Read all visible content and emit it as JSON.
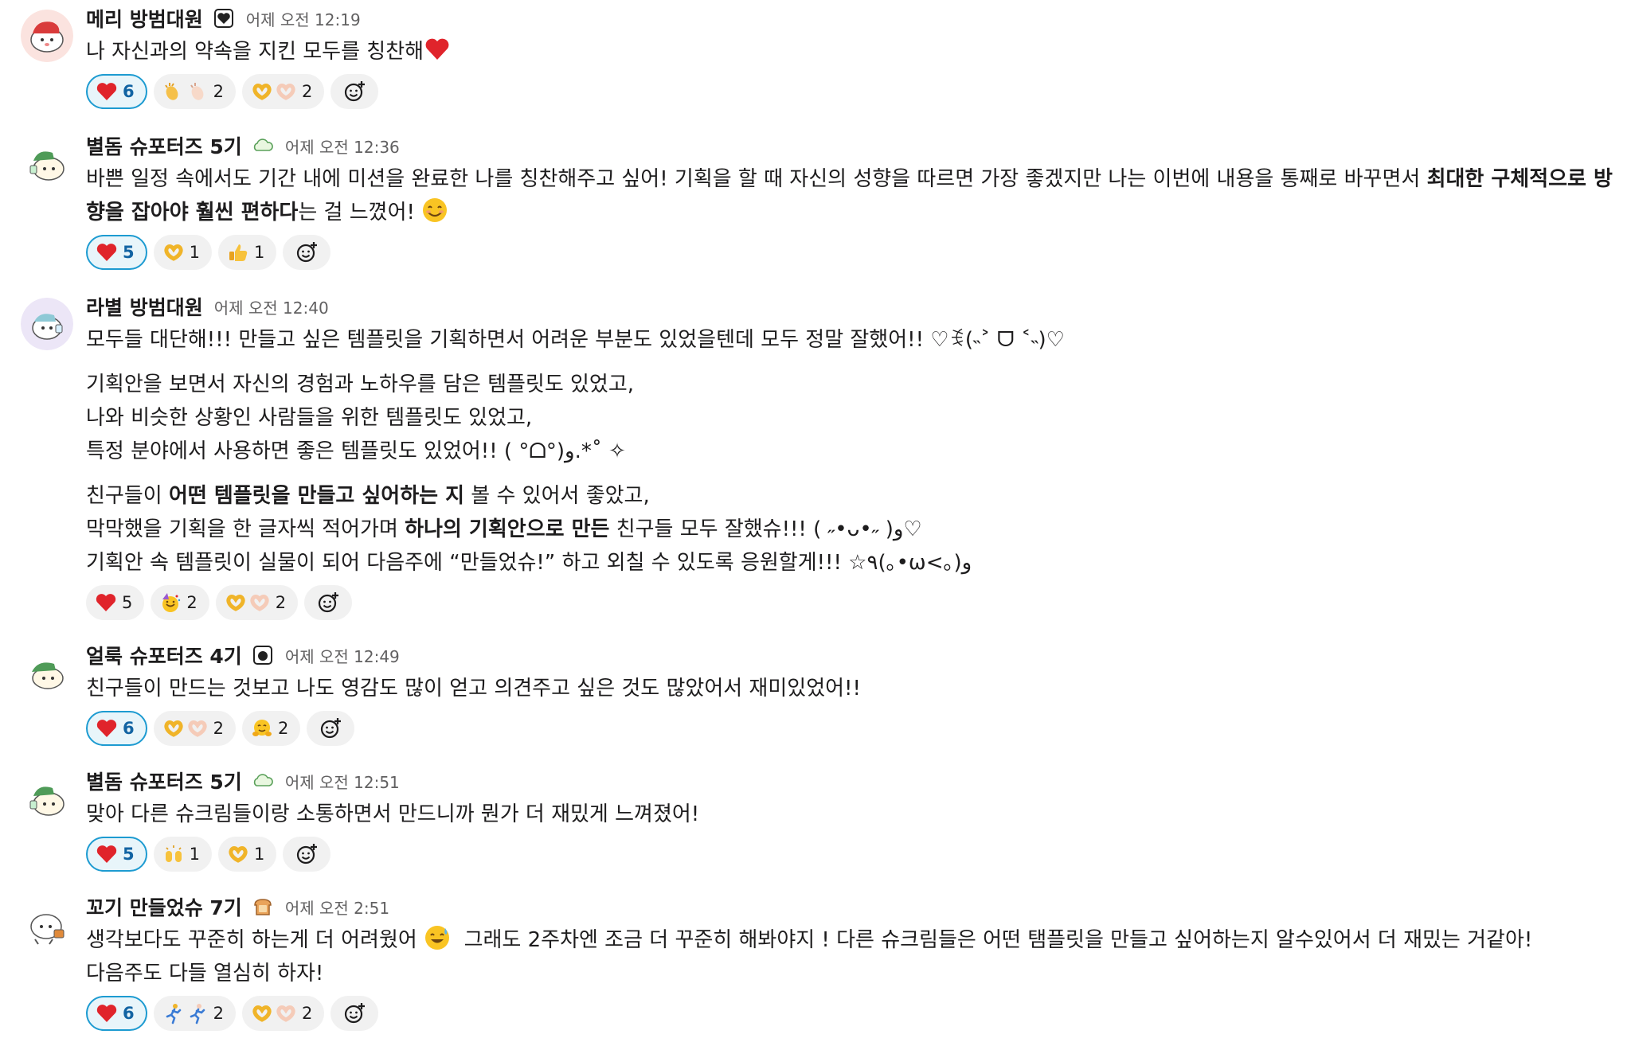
{
  "messages": [
    {
      "author": "메리 방범대원",
      "time": "어제 오전 12:19",
      "lines": [
        "나 자신과의 약속을 지킨 모두를 칭찬해"
      ],
      "reactions": [
        {
          "emoji": "heart",
          "count": "6",
          "mine": true
        },
        {
          "emoji": "clap",
          "count": "2"
        },
        {
          "emoji": "heart-hands",
          "count": "2"
        }
      ]
    },
    {
      "author": "별돔 슈포터즈 5기",
      "time": "어제 오전 12:36",
      "text_a": "바쁜 일정 속에서도 기간 내에 미션을 완료한 나를 칭찬해주고 싶어! 기획을 할 때 자신의 성향을 따르면 가장 좋겠지만 나는 이번에 내용을 통째로 바꾸면서 ",
      "text_bold": "최대한 구체적으로 방향을 잡아야 훨씬 편하다",
      "text_b": "는 걸 느꼈어!",
      "reactions": [
        {
          "emoji": "heart",
          "count": "5",
          "mine": true
        },
        {
          "emoji": "heart-hands",
          "count": "1"
        },
        {
          "emoji": "thumbs-up",
          "count": "1"
        }
      ]
    },
    {
      "author": "라별 방범대원",
      "time": "어제 오전 12:40",
      "p1": "모두들 대단해!!! 만들고 싶은 템플릿을 기획하면서 어려운 부분도 있었을텐데 모두 정말 잘했어!! ♡ꉂ(˵˃ ᗜ ˂˵)♡",
      "p2_lines": [
        "기획안을 보면서 자신의 경험과 노하우를 담은 템플릿도 있었고,",
        "나와 비슷한 상황인 사람들을 위한 템플릿도 있었고,",
        "특정 분야에서 사용하면 좋은 템플릿도 있었어!! ( °ᗝ°)و.*˚ ✧"
      ],
      "p3_l1_a": "친구들이 ",
      "p3_l1_bold": "어떤 템플릿을 만들고 싶어하는 지",
      "p3_l1_b": " 볼 수 있어서 좋았고,",
      "p3_l2_a": "막막했을 기획을 한 글자씩 적어가며 ",
      "p3_l2_bold": "하나의 기획안으로 만든",
      "p3_l2_b": " 친구들 모두 잘했슈!!! ( ˶•ᴗ•˶ )و♡",
      "p3_l3": "기획안 속 템플릿이 실물이 되어 다음주에 “만들었슈!” 하고 외칠 수 있도록 응원할게!!! ☆٩(｡•ω<｡)و",
      "reactions": [
        {
          "emoji": "heart",
          "count": "5"
        },
        {
          "emoji": "party-face",
          "count": "2"
        },
        {
          "emoji": "heart-hands",
          "count": "2"
        }
      ]
    },
    {
      "author": "얼룩 슈포터즈 4기",
      "time": "어제 오전 12:49",
      "lines": [
        "친구들이 만드는 것보고 나도 영감도 많이 얻고 의견주고 싶은 것도 많았어서 재미있었어!!"
      ],
      "reactions": [
        {
          "emoji": "heart",
          "count": "6",
          "mine": true
        },
        {
          "emoji": "heart-hands",
          "count": "2"
        },
        {
          "emoji": "hugging-face",
          "count": "2"
        }
      ]
    },
    {
      "author": "별돔 슈포터즈 5기",
      "time": "어제 오전 12:51",
      "lines": [
        "맞아 다른 슈크림들이랑 소통하면서 만드니까 뭔가 더 재밌게 느껴졌어!"
      ],
      "reactions": [
        {
          "emoji": "heart",
          "count": "5",
          "mine": true
        },
        {
          "emoji": "raised-hands",
          "count": "1"
        },
        {
          "emoji": "heart-hands",
          "count": "1"
        }
      ]
    },
    {
      "author": "꼬기 만들었슈 7기",
      "time": "어제 오전 2:51",
      "text_a": "생각보다도 꾸준히 하는게 더 어려웠어",
      "text_b": "그래도 2주차엔 조금 더 꾸준히 해봐야지 ! 다른 슈크림들은 어떤 탬플릿을 만들고 싶어하는지 알수있어서 더 재밌는 거같아!",
      "line2": "다음주도 다들 열심히 하자!",
      "reactions": [
        {
          "emoji": "heart",
          "count": "6",
          "mine": true
        },
        {
          "emoji": "running",
          "count": "2"
        },
        {
          "emoji": "heart-hands",
          "count": "2"
        }
      ]
    }
  ],
  "colors": {
    "reaction_mine_bg": "#e8f5fa",
    "reaction_mine_border": "#1d9bd1",
    "reaction_bg": "#f1f1f1",
    "timestamp": "#616061",
    "text": "#1d1c1d"
  },
  "icons": {
    "add_reaction": "add-reaction-icon"
  }
}
